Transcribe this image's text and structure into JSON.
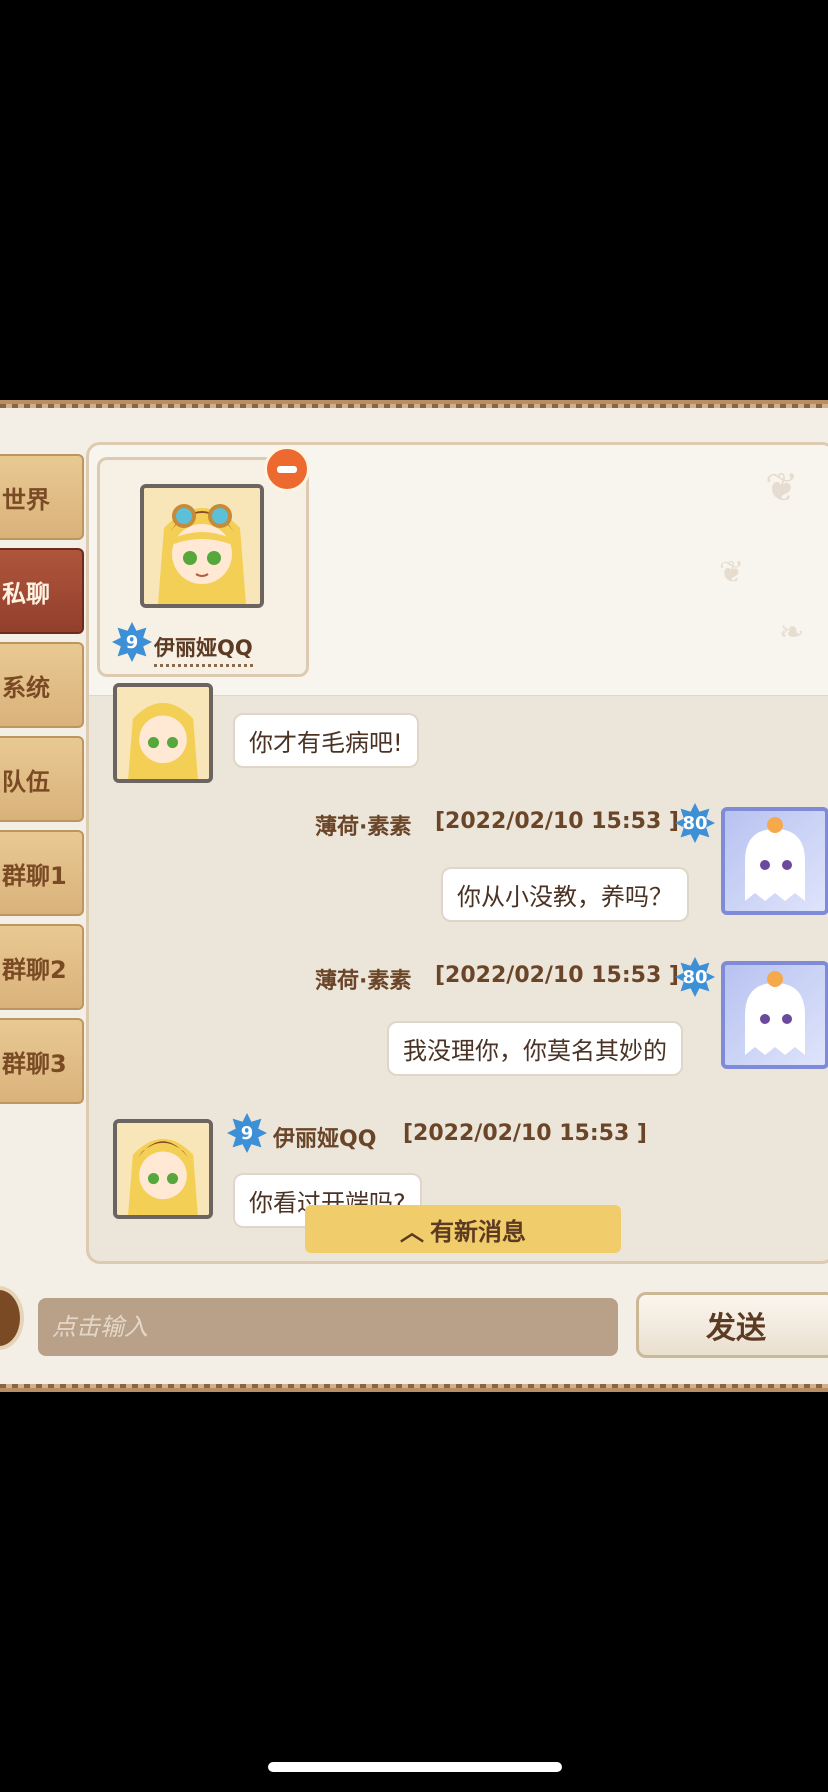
{
  "tabs": [
    {
      "label": "世界"
    },
    {
      "label": "私聊",
      "active": true
    },
    {
      "label": "系统"
    },
    {
      "label": "队伍"
    },
    {
      "label": "群聊1"
    },
    {
      "label": "群聊2"
    },
    {
      "label": "群聊3"
    }
  ],
  "contact": {
    "name": "伊丽娅QQ",
    "level": "9"
  },
  "messages": [
    {
      "sender": "伊丽娅QQ",
      "text": "你才有毛病吧!"
    },
    {
      "sender": "薄荷·素素",
      "level": "80",
      "time": "[2022/02/10 15:53 ]",
      "text": "你从小没教，养吗？"
    },
    {
      "sender": "薄荷·素素",
      "level": "80",
      "time": "[2022/02/10 15:53 ]",
      "text": "我没理你，你莫名其妙的"
    },
    {
      "sender": "伊丽娅QQ",
      "level": "9",
      "time": "[2022/02/10 15:53 ]",
      "text": "你看过开端吗?"
    }
  ],
  "new_messages_label": "有新消息",
  "input": {
    "placeholder": "点击输入"
  },
  "send_label": "发送",
  "colors": {
    "active_tab": "#923f2d",
    "tab": "#d9b27a",
    "new_message_bar": "#f0cc6a",
    "remove": "#ec6a2f"
  }
}
